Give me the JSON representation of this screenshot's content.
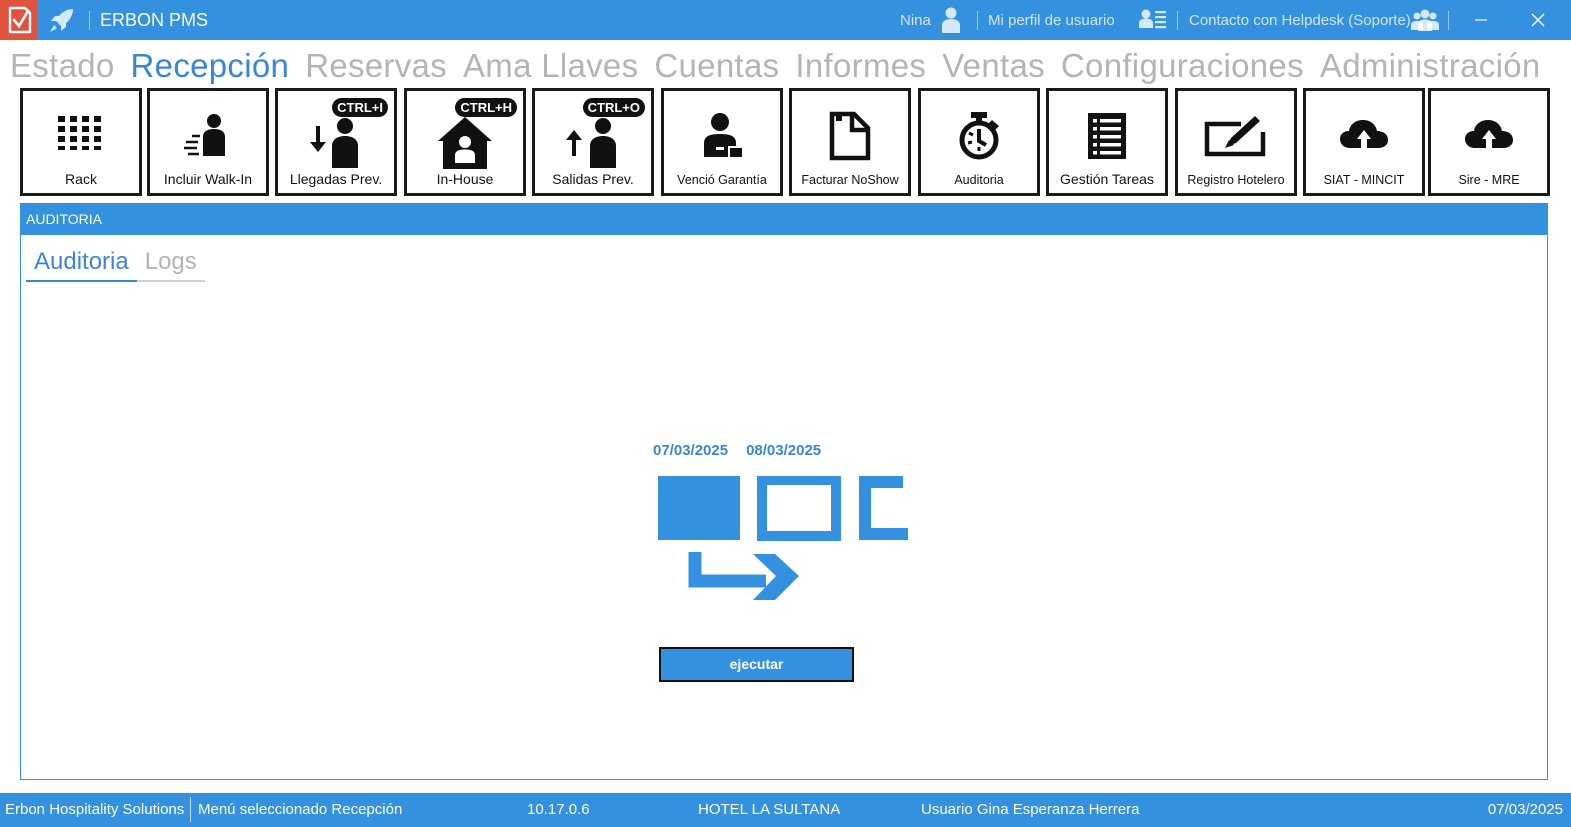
{
  "titlebar": {
    "app_title": "ERBON PMS",
    "user_name": "Nina",
    "profile_link": "Mi perfil de usuario",
    "helpdesk_link": "Contacto con Helpdesk (Soporte)"
  },
  "menu": {
    "items": [
      {
        "label": "Estado",
        "active": false
      },
      {
        "label": "Recepción",
        "active": true
      },
      {
        "label": "Reservas",
        "active": false
      },
      {
        "label": "Ama Llaves",
        "active": false
      },
      {
        "label": "Cuentas",
        "active": false
      },
      {
        "label": "Informes",
        "active": false
      },
      {
        "label": "Ventas",
        "active": false
      },
      {
        "label": "Configuraciones",
        "active": false
      },
      {
        "label": "Administración",
        "active": false
      }
    ]
  },
  "toolbar": {
    "buttons": [
      {
        "label": "Rack",
        "icon": "grid-icon"
      },
      {
        "label": "Incluir Walk-In",
        "icon": "walk-in-icon"
      },
      {
        "label": "Llegadas Prev.",
        "icon": "arrival-icon",
        "shortcut": "CTRL+I"
      },
      {
        "label": "In-House",
        "icon": "house-icon",
        "shortcut": "CTRL+H"
      },
      {
        "label": "Salidas Prev.",
        "icon": "departure-icon",
        "shortcut": "CTRL+O"
      },
      {
        "label": "Venció Garantía",
        "icon": "guarantee-icon"
      },
      {
        "label": "Facturar NoShow",
        "icon": "document-icon"
      },
      {
        "label": "Auditoria",
        "icon": "stopwatch-icon"
      },
      {
        "label": "Gestión Tareas",
        "icon": "task-list-icon"
      },
      {
        "label": "Registro Hotelero",
        "icon": "edit-icon"
      },
      {
        "label": "SIAT - MINCIT",
        "icon": "cloud-upload-icon"
      },
      {
        "label": "Sire - MRE",
        "icon": "cloud-upload-icon"
      }
    ]
  },
  "panel": {
    "header": "AUDITORIA",
    "tabs": [
      {
        "label": "Auditoria",
        "active": true
      },
      {
        "label": "Logs",
        "active": false
      }
    ],
    "date_from": "07/03/2025",
    "date_to": "08/03/2025",
    "execute_label": "ejecutar"
  },
  "statusbar": {
    "company": "Erbon Hospitality Solutions",
    "menu_selected": "Menú seleccionado  Recepción",
    "version": "10.17.0.6",
    "hotel": "HOTEL LA SULTANA",
    "user": "Usuario Gina Esperanza Herrera",
    "date": "07/03/2025"
  },
  "colors": {
    "accent": "#3491df",
    "active_text": "#3a86d4",
    "inactive_text": "#b4b4b4",
    "logo_red": "#e0533f"
  }
}
